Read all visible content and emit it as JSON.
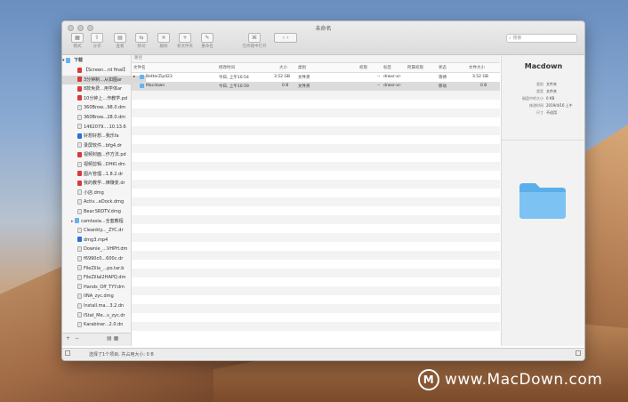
{
  "window": {
    "title": "未命名"
  },
  "toolbar": {
    "buttons": [
      {
        "name": "view-button",
        "label": "模式",
        "icon": "grid-icon"
      },
      {
        "name": "share-button",
        "label": "分享",
        "icon": "share-icon"
      },
      {
        "name": "copy-button",
        "label": "查看",
        "icon": "doc-icon"
      },
      {
        "name": "move-button",
        "label": "移动",
        "icon": "move-icon"
      },
      {
        "name": "delete-button",
        "label": "删除",
        "icon": "trash-icon"
      },
      {
        "name": "new-folder-button",
        "label": "新文件夹",
        "icon": "folder-plus-icon"
      },
      {
        "name": "rename-button",
        "label": "重命名",
        "icon": "rename-icon"
      },
      {
        "name": "run-button",
        "label": "在终端中打开",
        "icon": "terminal-icon"
      },
      {
        "name": "back-forward-button",
        "label": "< >",
        "icon": "chevron-icon"
      }
    ],
    "search_placeholder": "搜索"
  },
  "sidebar": {
    "header": "下载",
    "items": [
      {
        "label": "【Screen...rd final】",
        "icon": "pdf"
      },
      {
        "label": "3分钟制...从如图ar",
        "icon": "pdf",
        "selected": true
      },
      {
        "label": "8款免费...用学体ar",
        "icon": "pdf"
      },
      {
        "label": "10分钟上...作教学.pd",
        "icon": "pdf"
      },
      {
        "label": "360Brow...98.0.dm",
        "icon": "file"
      },
      {
        "label": "360Brow...28.0.dm",
        "icon": "file"
      },
      {
        "label": "1462079....10.13.6",
        "icon": "file"
      },
      {
        "label": "好想好想...我乐fa",
        "icon": "doc"
      },
      {
        "label": "录屏软件...bfg4.dr",
        "icon": "file"
      },
      {
        "label": "视频封面...作方法.pd",
        "icon": "pdf"
      },
      {
        "label": "视频剪辑...DHKI.dm",
        "icon": "file"
      },
      {
        "label": "图片管理...1.8.2.dr",
        "icon": "pdf"
      },
      {
        "label": "我的教学...律赚变.dr",
        "icon": "pdf"
      },
      {
        "label": "小店.dmg",
        "icon": "file"
      },
      {
        "label": "Activ...eDock.dmg",
        "icon": "file"
      },
      {
        "label": "Bear.SRDTV.dmg",
        "icon": "file"
      },
      {
        "label": "camtasia...全套教程",
        "icon": "folder"
      },
      {
        "label": "Cleankly..._ZYC.dr",
        "icon": "file"
      },
      {
        "label": "dmg3.mp4",
        "icon": "doc"
      },
      {
        "label": "Downie_...VHPH.dm",
        "icon": "file"
      },
      {
        "label": "f6990c0...600c.dr",
        "icon": "file"
      },
      {
        "label": "FileZilla_...po.tar.b",
        "icon": "file"
      },
      {
        "label": "FileZillaI2HAPQ.dm",
        "icon": "file"
      },
      {
        "label": "Hands_Off_TYY.dm",
        "icon": "file"
      },
      {
        "label": "IINA_zyc.dmg",
        "icon": "file"
      },
      {
        "label": "Install.ma...3.2.dn",
        "icon": "file"
      },
      {
        "label": "IStat_Me...s_zyc.dr",
        "icon": "file"
      },
      {
        "label": "Karabiner...2.0.dn",
        "icon": "file"
      }
    ],
    "bottom": {
      "add": "+",
      "remove": "−"
    }
  },
  "main": {
    "path": "路径",
    "columns": [
      "文件名",
      "修改时间",
      "大小",
      "类别",
      "权限",
      "标签",
      "所属权限",
      "组别",
      "状态",
      "文件大小"
    ],
    "rows": [
      {
        "name": "BetterZip423",
        "date": "今日, 上午10:54",
        "size": "3.52 GB",
        "kind": "文件夹",
        "perm": "--",
        "attr": "drwxr-xr-",
        "state": "等待",
        "filesize": "3.52 GB"
      },
      {
        "name": "Macdown",
        "date": "今日, 上午10:59",
        "size": "0 B",
        "kind": "文件夹",
        "perm": "--",
        "attr": "drwxr-xr-",
        "state": "移动",
        "filesize": "0 B"
      }
    ]
  },
  "preview": {
    "title": "Macdown",
    "fields": [
      {
        "k": "类别",
        "v": "文件夹"
      },
      {
        "k": "类型",
        "v": "文件夹"
      },
      {
        "k": "磁盘中的大小",
        "v": "0 KB"
      },
      {
        "k": "修改时间",
        "v": "2019/4/16 上午"
      },
      {
        "k": "尺寸",
        "v": "不适用"
      }
    ]
  },
  "status": {
    "text": "选择了1个项目, 共占用大小: 0 B"
  },
  "watermark": {
    "text": "www.MacDown.com"
  }
}
